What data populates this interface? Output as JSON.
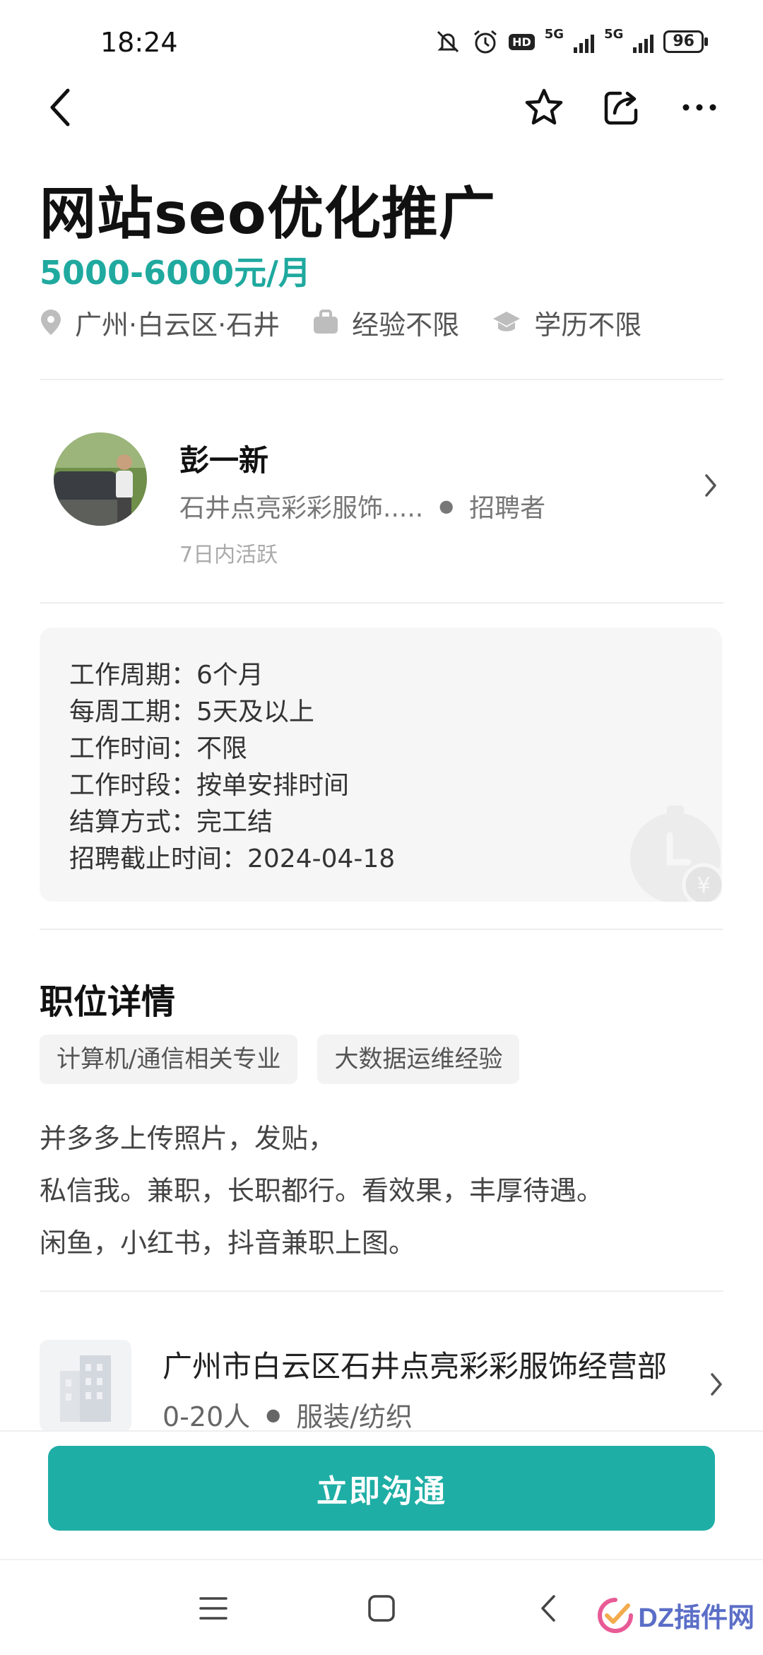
{
  "status_bar": {
    "time": "18:24",
    "battery": "96",
    "network": [
      "5G",
      "5G"
    ],
    "hd": "HD"
  },
  "header": {
    "back_icon": "chevron-left-icon",
    "favorite_icon": "star-icon",
    "share_icon": "share-icon",
    "more_icon": "more-horizontal-icon"
  },
  "job": {
    "title": "网站seo优化推广",
    "salary": "5000-6000元/月",
    "location": "广州·白云区·石井",
    "experience": "经验不限",
    "education": "学历不限",
    "accent_color": "#1fa99f"
  },
  "recruiter": {
    "name": "彭一新",
    "company": "石井点亮彩彩服饰.....",
    "role": "招聘者",
    "active": "7日内活跃"
  },
  "info": [
    "工作周期：6个月",
    "每周工期：5天及以上",
    "工作时间：不限",
    "工作时段：按单安排时间",
    "结算方式：完工结",
    "招聘截止时间：2024-04-18"
  ],
  "details": {
    "title": "职位详情",
    "tags": [
      "计算机/通信相关专业",
      "大数据运维经验"
    ],
    "description": [
      "并多多上传照片，发贴，",
      "私信我。兼职，长职都行。看效果，丰厚待遇。",
      "闲鱼，小红书，抖音兼职上图。"
    ]
  },
  "company": {
    "name": "广州市白云区石井点亮彩彩服饰经营部",
    "size": "0-20人",
    "industry": "服装/纺织"
  },
  "cta": {
    "label": "立即沟通",
    "color": "#1eaea5"
  },
  "watermark": {
    "text": "DZ插件网"
  }
}
